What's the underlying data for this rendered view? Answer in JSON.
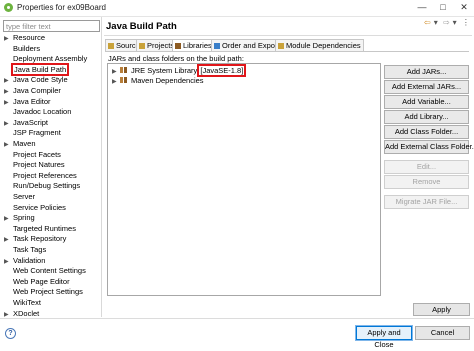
{
  "window": {
    "title": "Properties for ex09Board",
    "minimize_glyph": "—",
    "maximize_glyph": "□",
    "close_glyph": "✕"
  },
  "sidebar": {
    "filter_placeholder": "type filter text",
    "items": [
      {
        "label": "Resource",
        "expandable": true
      },
      {
        "label": "Builders",
        "expandable": false
      },
      {
        "label": "Deployment Assembly",
        "expandable": false
      },
      {
        "label": "Java Build Path",
        "expandable": false,
        "selected": true
      },
      {
        "label": "Java Code Style",
        "expandable": true
      },
      {
        "label": "Java Compiler",
        "expandable": true
      },
      {
        "label": "Java Editor",
        "expandable": true
      },
      {
        "label": "Javadoc Location",
        "expandable": false
      },
      {
        "label": "JavaScript",
        "expandable": true
      },
      {
        "label": "JSP Fragment",
        "expandable": false
      },
      {
        "label": "Maven",
        "expandable": true
      },
      {
        "label": "Project Facets",
        "expandable": false
      },
      {
        "label": "Project Natures",
        "expandable": false
      },
      {
        "label": "Project References",
        "expandable": false
      },
      {
        "label": "Run/Debug Settings",
        "expandable": false
      },
      {
        "label": "Server",
        "expandable": false
      },
      {
        "label": "Service Policies",
        "expandable": false
      },
      {
        "label": "Spring",
        "expandable": true
      },
      {
        "label": "Targeted Runtimes",
        "expandable": false
      },
      {
        "label": "Task Repository",
        "expandable": true
      },
      {
        "label": "Task Tags",
        "expandable": false
      },
      {
        "label": "Validation",
        "expandable": true
      },
      {
        "label": "Web Content Settings",
        "expandable": false
      },
      {
        "label": "Web Page Editor",
        "expandable": false
      },
      {
        "label": "Web Project Settings",
        "expandable": false
      },
      {
        "label": "WikiText",
        "expandable": false
      },
      {
        "label": "XDoclet",
        "expandable": true
      }
    ]
  },
  "panel": {
    "title": "Java Build Path",
    "nav": {
      "back": "⇦",
      "back_menu": "▾",
      "forward": "⇨",
      "forward_menu": "▾",
      "menu": "⋮"
    },
    "tabs": [
      {
        "label": "Source",
        "active": false,
        "icon_color": "#c9a23a"
      },
      {
        "label": "Projects",
        "active": false,
        "icon_color": "#c9a23a"
      },
      {
        "label": "Libraries",
        "active": true,
        "icon_color": "#8d5b22"
      },
      {
        "label": "Order and Export",
        "active": false,
        "icon_color": "#3a7fc9"
      },
      {
        "label": "Module Dependencies",
        "active": false,
        "icon_color": "#c9a23a"
      }
    ],
    "list_caption": "JARs and class folders on the build path:",
    "classpath": [
      {
        "label": "JRE System Library",
        "tag": "[JavaSE-1.8]"
      },
      {
        "label": "Maven Dependencies",
        "tag": ""
      }
    ],
    "buttons": [
      {
        "label": "Add JARs...",
        "enabled": true
      },
      {
        "label": "Add External JARs...",
        "enabled": true
      },
      {
        "label": "Add Variable...",
        "enabled": true
      },
      {
        "label": "Add Library...",
        "enabled": true
      },
      {
        "label": "Add Class Folder...",
        "enabled": true
      },
      {
        "label": "Add External Class Folder...",
        "enabled": true
      },
      {
        "label": "Edit...",
        "enabled": false
      },
      {
        "label": "Remove",
        "enabled": false
      },
      {
        "label": "Migrate JAR File...",
        "enabled": false
      }
    ],
    "apply_label": "Apply"
  },
  "footer": {
    "help_glyph": "?",
    "apply_close_label": "Apply and Close",
    "cancel_label": "Cancel"
  },
  "colors": {
    "highlight_box": "#e0161a",
    "primary_button_border": "#0078d7",
    "app_logo": "#6db33f"
  }
}
